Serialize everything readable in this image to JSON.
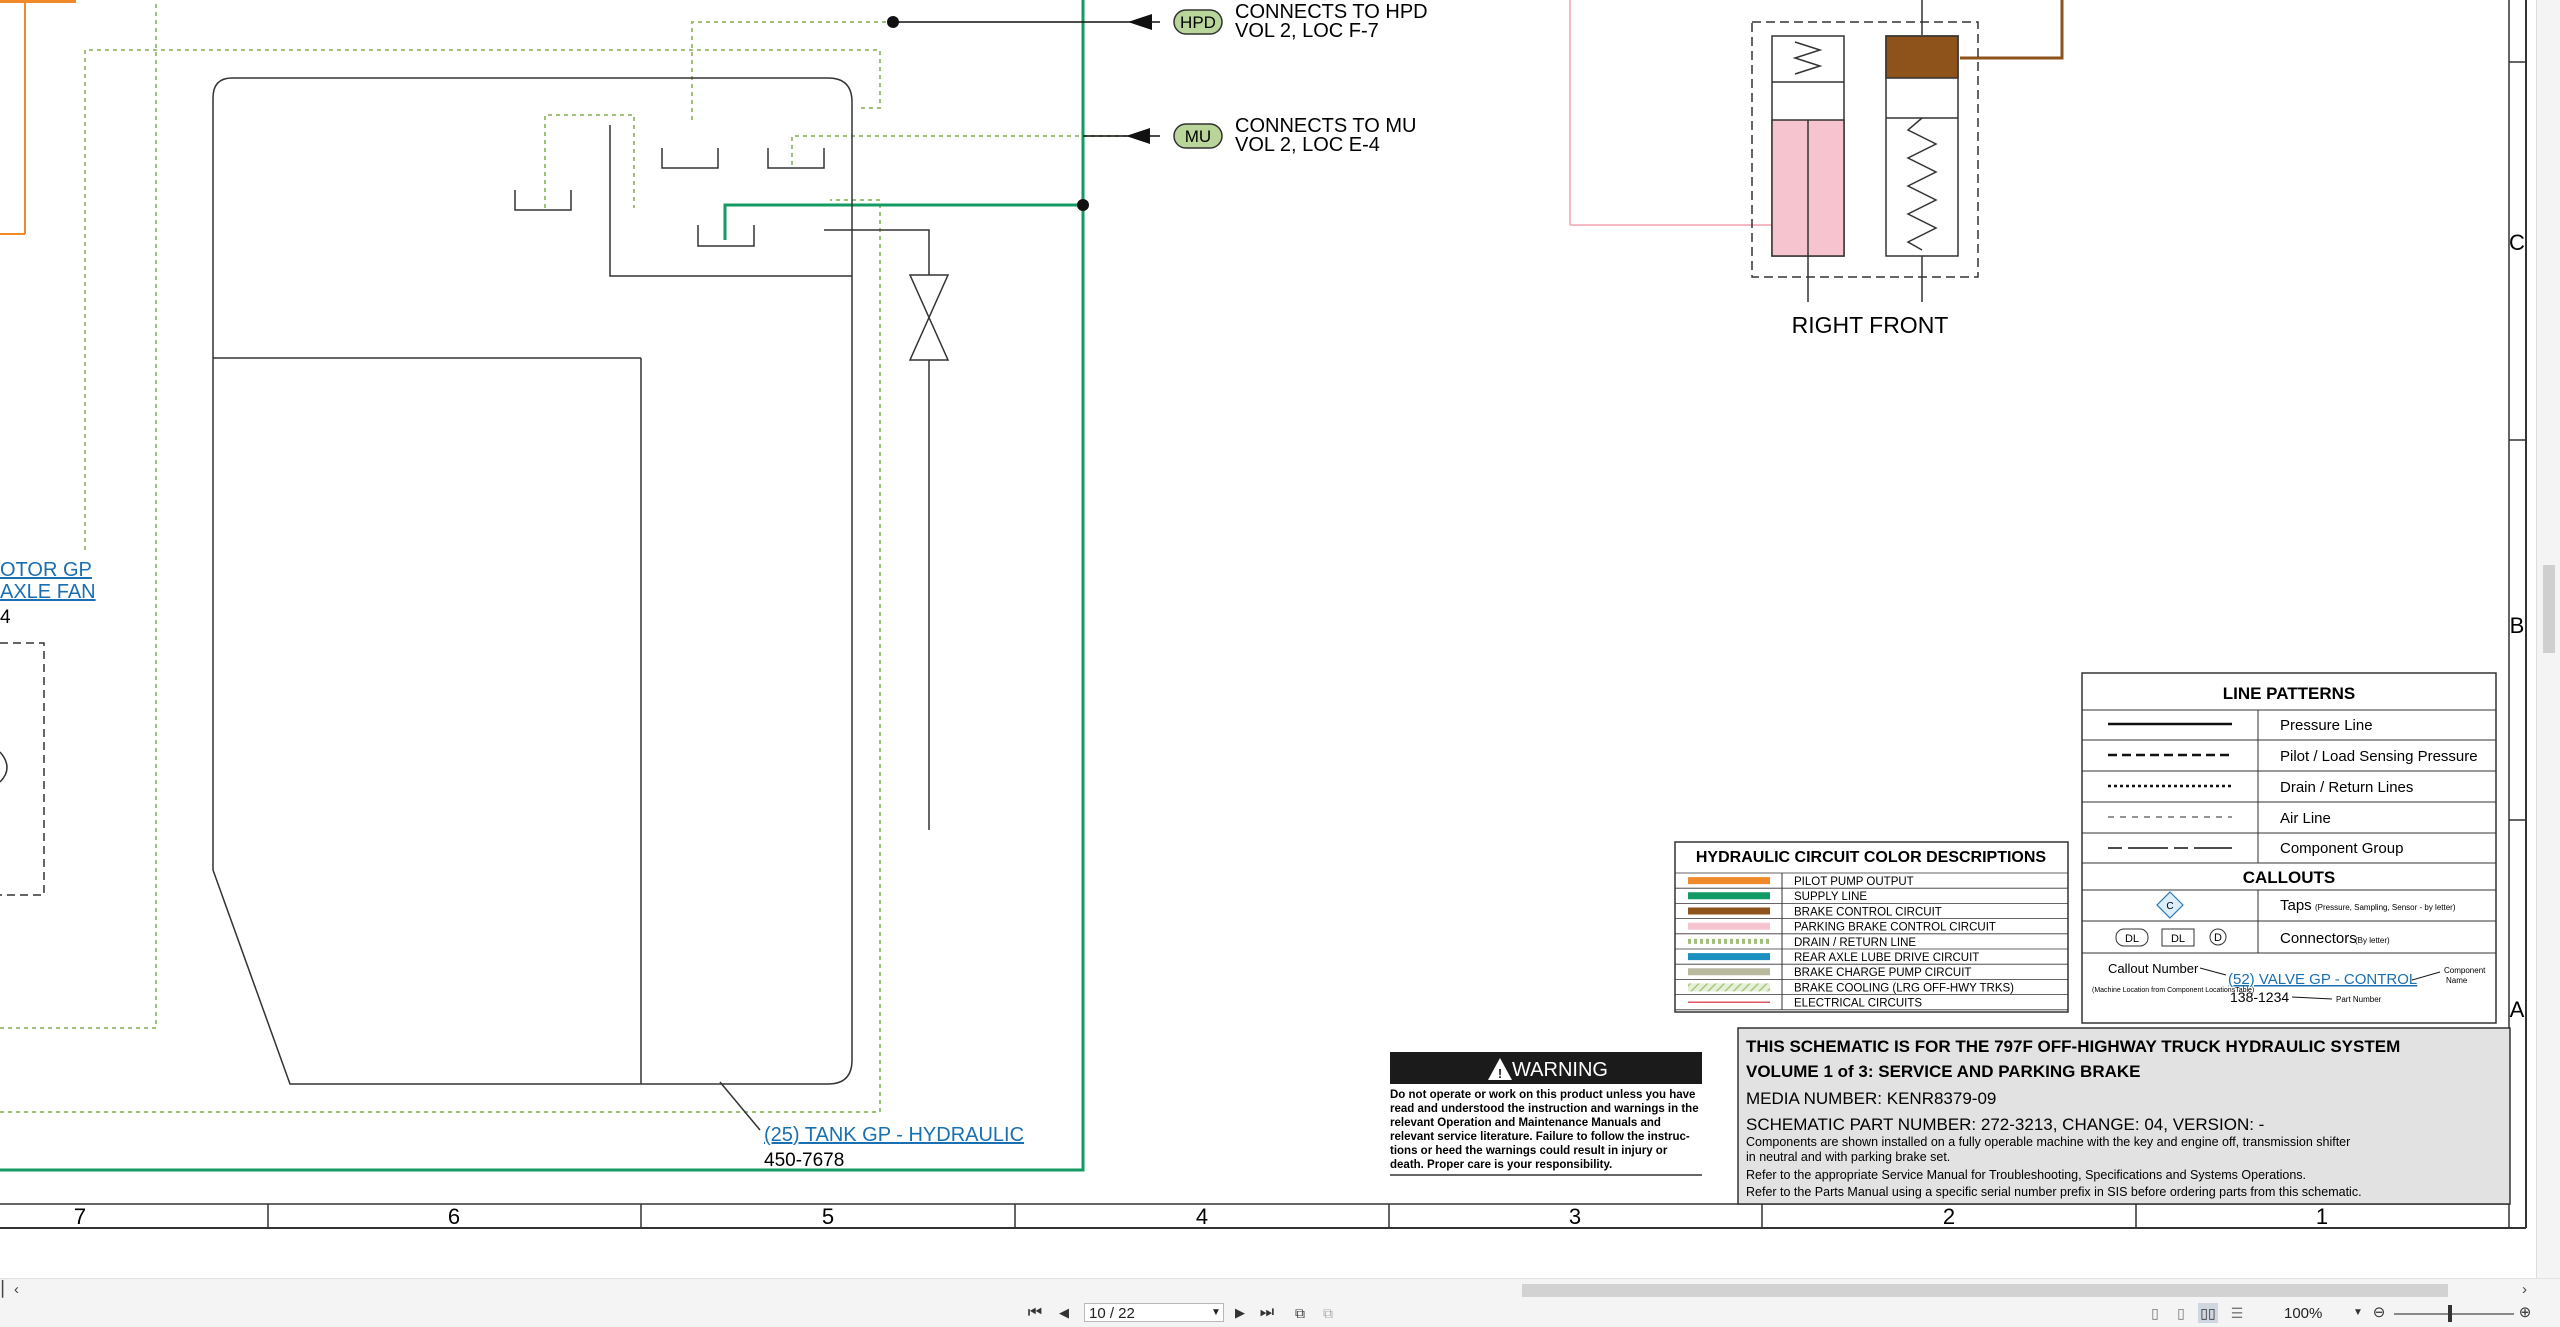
{
  "schematic": {
    "connector_hpd": {
      "tag": "HPD",
      "line1": "CONNECTS TO HPD",
      "line2": "VOL 2, LOC F-7"
    },
    "connector_mu": {
      "tag": "MU",
      "line1": "CONNECTS TO MU",
      "line2": "VOL 2, LOC E-4"
    },
    "left_component": {
      "link_line1": "OTOR GP",
      "link_line2": "AXLE FAN",
      "part": "4"
    },
    "tank": {
      "link": "(25) TANK GP - HYDRAULIC",
      "part": "450-7678"
    },
    "right_front_label": "RIGHT FRONT",
    "zone_letters": [
      "C",
      "B",
      "A"
    ],
    "zone_numbers": [
      "7",
      "6",
      "5",
      "4",
      "3",
      "2",
      "1"
    ]
  },
  "line_patterns": {
    "title": "LINE PATTERNS",
    "rows": [
      "Pressure Line",
      "Pilot / Load Sensing Pressure",
      "Drain / Return Lines",
      "Air Line",
      "Component Group"
    ],
    "callouts_title": "CALLOUTS",
    "taps_label": "Taps",
    "taps_small": "(Pressure, Sampling, Sensor - by letter)",
    "connectors_label": "Connectors",
    "connectors_small": "(By letter)",
    "connector_icons": [
      "DL",
      "DL",
      "D"
    ],
    "taps_icon": "C",
    "callout_number": "Callout Number",
    "callout_small": "(Machine Location from Component LocationsTable)",
    "callout_example": "(52) VALVE GP - CONTROL",
    "callout_part": "138-1234",
    "component_name": "Component",
    "component_name2": "Name",
    "part_number": "Part Number"
  },
  "color_descriptions": {
    "title": "HYDRAULIC CIRCUIT COLOR DESCRIPTIONS",
    "rows": [
      {
        "label": "PILOT PUMP OUTPUT",
        "color": "#f0892a",
        "style": "solid"
      },
      {
        "label": "SUPPLY LINE",
        "color": "#129b62",
        "style": "solid"
      },
      {
        "label": "BRAKE CONTROL CIRCUIT",
        "color": "#8e531a",
        "style": "solid"
      },
      {
        "label": "PARKING BRAKE CONTROL CIRCUIT",
        "color": "#f6c4cf",
        "style": "solid"
      },
      {
        "label": "DRAIN / RETURN LINE",
        "color": "#9fbf7a",
        "style": "dotted"
      },
      {
        "label": "REAR AXLE LUBE DRIVE CIRCUIT",
        "color": "#1a8fc0",
        "style": "solid"
      },
      {
        "label": "BRAKE CHARGE PUMP CIRCUIT",
        "color": "#b9b9a0",
        "style": "solid"
      },
      {
        "label": "BRAKE COOLING (LRG OFF-HWY TRKS)",
        "color": "#c7dca8",
        "style": "hatched"
      },
      {
        "label": "ELECTRICAL CIRCUITS",
        "color": "#e05566",
        "style": "thin"
      }
    ]
  },
  "warning": {
    "title": "WARNING",
    "lines": [
      "Do not operate or work on this product unless you have",
      "read and understood the instruction and warnings in the",
      "relevant Operation and Maintenance Manuals and",
      "relevant service literature. Failure to follow the instruc-",
      "tions or heed the warnings could result in injury or",
      "death. Proper care is your responsibility."
    ]
  },
  "title_block": {
    "line1": "THIS SCHEMATIC IS FOR THE 797F OFF-HIGHWAY TRUCK HYDRAULIC SYSTEM",
    "line2": "VOLUME 1 of 3: SERVICE AND PARKING BRAKE",
    "line3": "MEDIA NUMBER: KENR8379-09",
    "line4": "SCHEMATIC PART NUMBER: 272-3213, CHANGE: 04, VERSION: -",
    "line5": "Components are shown installed on a fully operable machine with the key and engine off, transmission shifter",
    "line6": "in neutral and with parking brake set.",
    "line7": "Refer to the appropriate Service Manual for Troubleshooting, Specifications and Systems Operations.",
    "line8": "Refer to the Parts Manual using a specific serial number prefix in SIS before ordering parts from this schematic."
  },
  "viewer": {
    "page_value": "10 / 22",
    "zoom": "100%",
    "buttons": {
      "first": "⏮",
      "prev": "◀",
      "next": "▶",
      "last": "⏭"
    }
  }
}
